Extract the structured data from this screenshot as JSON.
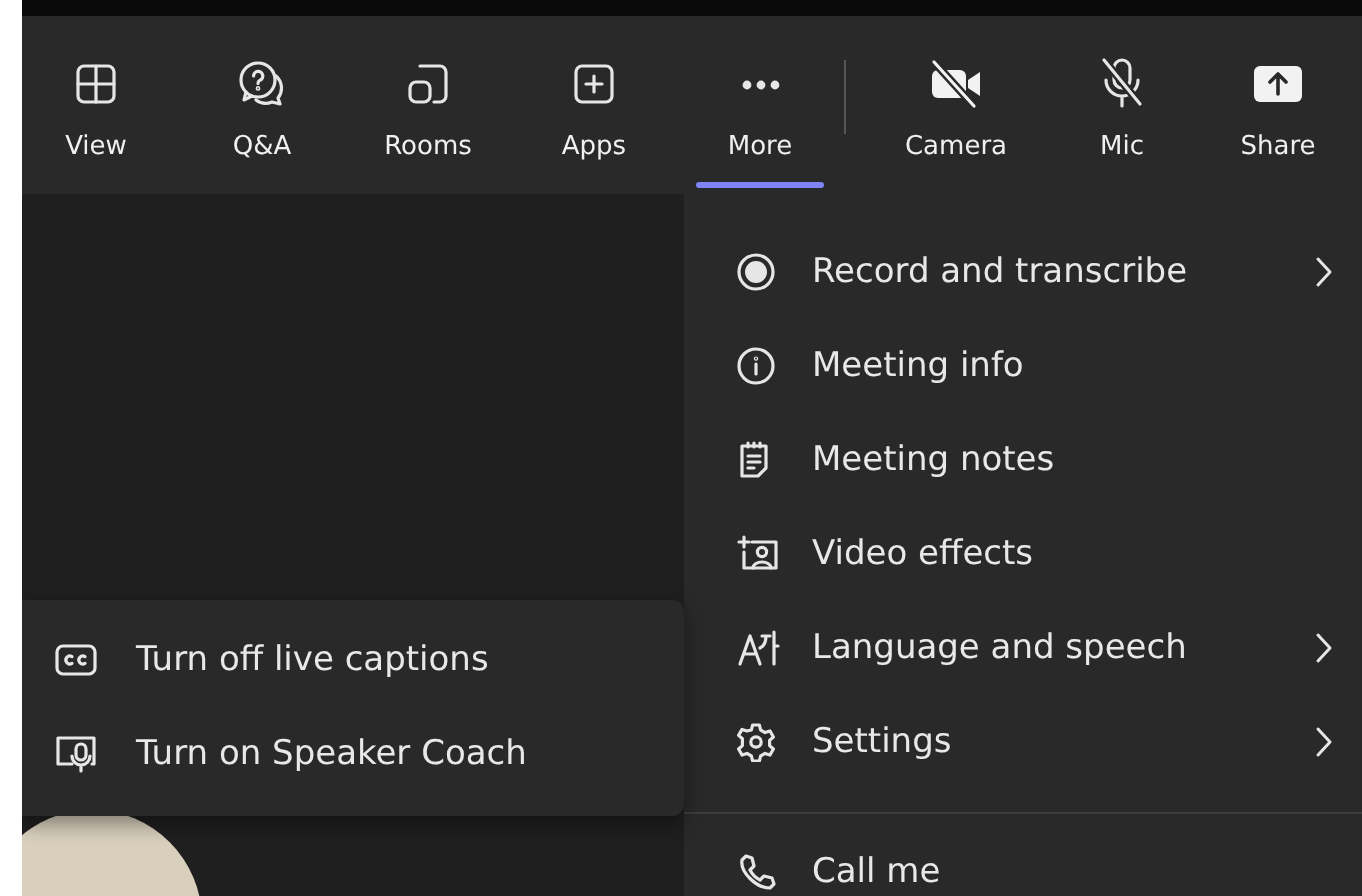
{
  "toolbar": {
    "buttons": [
      {
        "label": "View",
        "selected": false
      },
      {
        "label": "Q&A",
        "selected": false
      },
      {
        "label": "Rooms",
        "selected": false
      },
      {
        "label": "Apps",
        "selected": false
      },
      {
        "label": "More",
        "selected": true
      },
      {
        "label": "Camera",
        "selected": false,
        "off": true
      },
      {
        "label": "Mic",
        "selected": false,
        "off": true
      },
      {
        "label": "Share",
        "selected": false
      }
    ]
  },
  "more_menu": {
    "items": [
      {
        "label": "Record and transcribe",
        "has_submenu": true
      },
      {
        "label": "Meeting info",
        "has_submenu": false
      },
      {
        "label": "Meeting notes",
        "has_submenu": false
      },
      {
        "label": "Video effects",
        "has_submenu": false
      },
      {
        "label": "Language and speech",
        "has_submenu": true
      },
      {
        "label": "Settings",
        "has_submenu": true
      }
    ],
    "footer_items": [
      {
        "label": "Call me"
      }
    ]
  },
  "language_submenu": {
    "items": [
      {
        "label": "Turn off live captions"
      },
      {
        "label": "Turn on Speaker Coach"
      }
    ]
  }
}
